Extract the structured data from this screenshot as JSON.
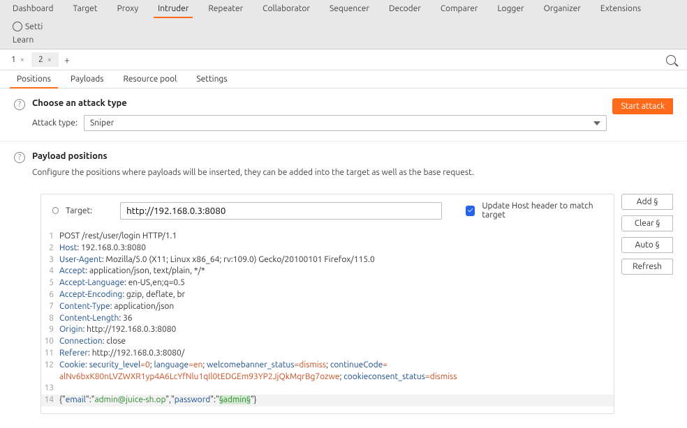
{
  "top_tabs": [
    "Dashboard",
    "Target",
    "Proxy",
    "Intruder",
    "Repeater",
    "Collaborator",
    "Sequencer",
    "Decoder",
    "Comparer",
    "Logger",
    "Organizer",
    "Extensions"
  ],
  "settings_label": "Setti",
  "learn_label": "Learn",
  "sub_tabs": [
    {
      "label": "1",
      "closable": true
    },
    {
      "label": "2",
      "closable": true
    }
  ],
  "inner_tabs": [
    "Positions",
    "Payloads",
    "Resource pool",
    "Settings"
  ],
  "attack": {
    "heading": "Choose an attack type",
    "label": "Attack type:",
    "value": "Sniper",
    "start": "Start attack"
  },
  "positions": {
    "heading": "Payload positions",
    "desc": "Configure the positions where payloads will be inserted, they can be added into the target as well as the base request.",
    "target_label": "Target:",
    "target_value": "http://192.168.0.3:8080",
    "update_host": "Update Host header to match target"
  },
  "buttons": {
    "add": "Add §",
    "clear": "Clear §",
    "auto": "Auto §",
    "refresh": "Refresh"
  },
  "request": {
    "line1": "POST /rest/user/login HTTP/1.1",
    "host_k": "Host",
    "host_v": ": 192.168.0.3:8080",
    "ua_k": "User-Agent",
    "ua_v": ": Mozilla/5.0 (X11; Linux x86_64; rv:109.0) Gecko/20100101 Firefox/115.0",
    "acc_k": "Accept",
    "acc_v": ": application/json, text/plain, */*",
    "al_k": "Accept-Language",
    "al_v": ": en-US,en;q=0.5",
    "ae_k": "Accept-Encoding",
    "ae_v": ": gzip, deflate, br",
    "ct_k": "Content-Type",
    "ct_v": ": application/json",
    "cl_k": "Content-Length",
    "cl_v": ": 36",
    "or_k": "Origin",
    "or_v": ": http://192.168.0.3:8080",
    "cn_k": "Connection",
    "cn_v": ": close",
    "rf_k": "Referer",
    "rf_v": ": http://192.168.0.3:8080/",
    "ck_k": "Cookie",
    "ck_v": ": ",
    "ck1_k": "security_level",
    "eq": "=",
    "ck1_v": "0",
    "sep": "; ",
    "ck2_k": "language",
    "ck2_v": "en",
    "ck3_k": "welcomebanner_status",
    "ck3_v": "dismiss",
    "ck4_k": "continueCode",
    "ck4_v": "alNv6bxK80nLVZWXR1yp4A6LcYfNlu1qIl0tEDGEm93YP2JjQkMqrBg7ozwe",
    "ck5_k": "cookieconsent_status",
    "ck5_v": "dismiss",
    "body_pre": "{\"",
    "body_email_k": "email",
    "body_mid": "\":\"",
    "body_email_v": "admin@juice-sh.op",
    "body_sep": "\",\"",
    "body_pw_k": "password",
    "body_pw_pre": "\":\"",
    "body_pw_v": "§admin§",
    "body_end": "\"}"
  }
}
